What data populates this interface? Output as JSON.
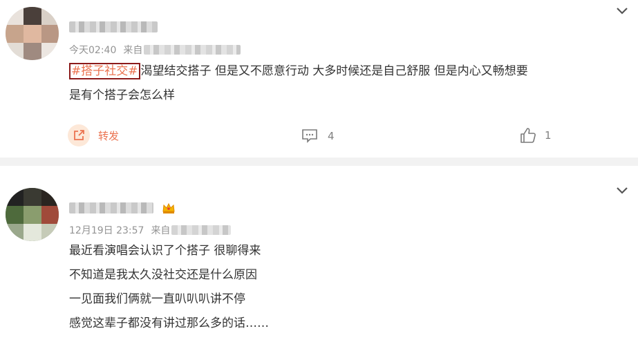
{
  "posts": [
    {
      "time": "今天02:40",
      "source_prefix": "来自",
      "topic": "#搭子社交#",
      "text_line1": "渴望结交搭子 但是又不愿意行动 大多时候还是自己舒服 但是内心又畅想要",
      "text_line2": "是有个搭子会怎么样",
      "actions": {
        "repost_label": "转发",
        "comment_count": "4",
        "like_count": "1"
      }
    },
    {
      "time": "12月19日 23:57",
      "source_prefix": "来自",
      "lines": [
        "最近看演唱会认识了个搭子 很聊得来",
        "不知道是我太久没社交还是什么原因",
        "一见面我们俩就一直叭叭叭讲不停",
        "感觉这辈子都没有讲过那么多的话……"
      ]
    }
  ],
  "colors": {
    "accent": "#eb7350",
    "meta": "#939393",
    "text": "#333333",
    "divider": "#f2f2f2",
    "topic_border": "#8b1a1a"
  },
  "icons": [
    "chevron-down-icon",
    "repost-icon",
    "comment-icon",
    "like-icon",
    "crown-badge-icon"
  ]
}
